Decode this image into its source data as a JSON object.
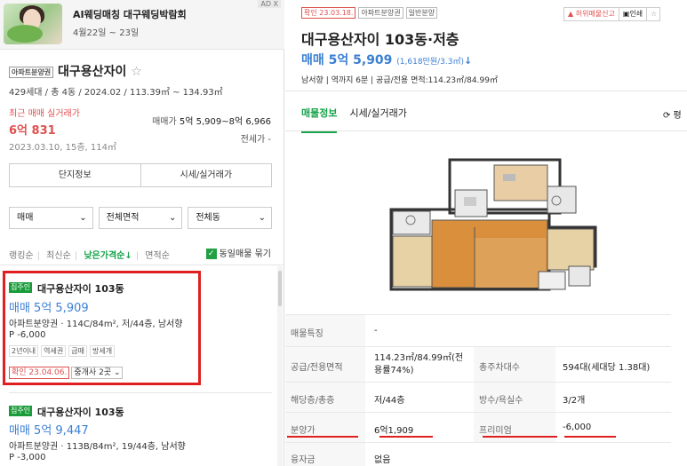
{
  "ad": {
    "badge": "AD X",
    "title": "AI웨딩매칭 대구웨딩박람회",
    "subtitle": "4월22일 ~ 23일"
  },
  "complex": {
    "type_tag": "아파트분양권",
    "name": "대구용산자이",
    "star": "☆",
    "info": "429세대 / 총 4동 / 2024.02 / 113.39㎡ ~ 134.93㎡",
    "recent_label": "최근 매매 실거래가",
    "recent_price": "6억 831",
    "recent_date": "2023.03.10, 15층, 114㎡",
    "range_label": "매매가",
    "range_value": "5억 5,909~8억 6,966",
    "jeonse": "전세가 -",
    "btn_info": "단지정보",
    "btn_price": "시세/실거래가"
  },
  "filters": {
    "trade": "매매",
    "area": "전체면적",
    "dong": "전체동",
    "chevron": "⌄"
  },
  "sort": {
    "items": [
      "랭킹순",
      "최신순",
      "낮은가격순↓",
      "면적순"
    ],
    "same_listing": "동일매물 묶기",
    "check": "✓"
  },
  "listings": [
    {
      "category": "집주인",
      "name": "대구용산자이 103동",
      "price": "매매 5억 5,909",
      "spec": "아파트분양권 · 114C/84m², 저/44층, 남서향",
      "premium": "P -6,000",
      "features": [
        "2년이내",
        "역세권",
        "급매",
        "방세개"
      ],
      "confirm": "확인 23.04.06.",
      "brokers": "중개사 2곳 ⌄"
    },
    {
      "category": "집주인",
      "name": "대구용산자이 103동",
      "price": "매매 5억 9,447",
      "spec": "아파트분양권 · 113B/84m², 19/44층, 남서향",
      "premium": "P -3,000"
    }
  ],
  "detail": {
    "tags": [
      "확인 23.03.18.",
      "아파트분양권",
      "일반분양"
    ],
    "report": "허위매물신고",
    "print": "인쇄",
    "fav": "☆",
    "title": "대구용산자이 103동·저층",
    "price": "매매 5억 5,909",
    "price_unit": "(1,618만원/3.3㎡)",
    "price_arrow": "↓",
    "info": "남서향 | 역까지 6분 | 공급/전용 면적:114.23㎡/84.99㎡",
    "tabs": [
      "매물정보",
      "시세/실거래가"
    ],
    "refresh": "⟳ 평",
    "table": [
      {
        "k": "매물특징",
        "v": "-"
      },
      {
        "k": "공급/전용면적",
        "v": "114.23㎡/84.99㎡(전용률74%)",
        "k2": "총주차대수",
        "v2": "594대(세대당 1.38대)"
      },
      {
        "k": "해당층/총층",
        "v": "저/44층",
        "k2": "방수/욕실수",
        "v2": "3/2개"
      },
      {
        "k": "분양가",
        "v": "6억1,909",
        "k2": "프리미엄",
        "v2": "-6,000"
      },
      {
        "k": "융자금",
        "v": "없음"
      }
    ]
  },
  "colors": {
    "accent_green": "#17a34a",
    "price_blue": "#3b7fd4",
    "alert_red": "#e02020"
  }
}
